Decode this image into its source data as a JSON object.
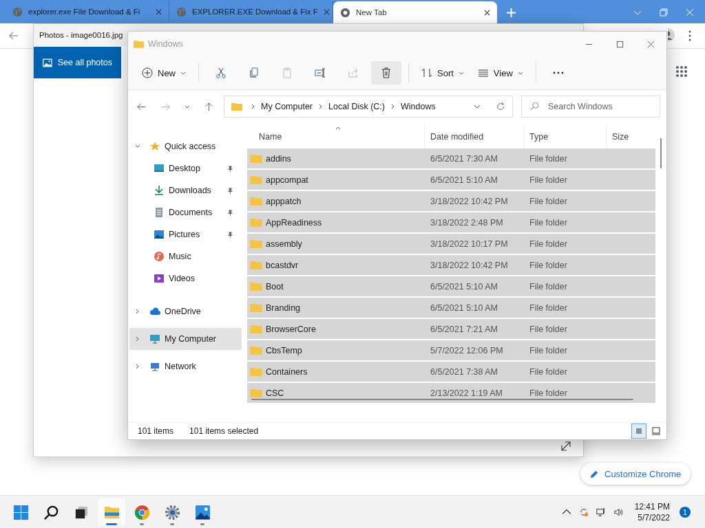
{
  "browser": {
    "tabs": [
      {
        "title": "explorer.exe File Download & Fi",
        "selected": false
      },
      {
        "title": "EXPLORER.EXE Download & Fix F",
        "selected": false
      },
      {
        "title": "New Tab",
        "selected": true
      }
    ],
    "customize_button": "Customize Chrome"
  },
  "photos_window": {
    "title": "Photos - image0016.jpg",
    "see_all": "See all photos"
  },
  "explorer": {
    "title": "Windows",
    "toolbar": {
      "new": "New",
      "sort": "Sort",
      "view": "View"
    },
    "breadcrumb": [
      "My Computer",
      "Local Disk (C:)",
      "Windows"
    ],
    "search": {
      "placeholder": "Search Windows"
    },
    "nav": [
      {
        "label": "Quick access",
        "kind": "star",
        "expanded": true,
        "selected": false,
        "children": [
          {
            "label": "Desktop",
            "kind": "desktop",
            "pinned": true,
            "selected": false
          },
          {
            "label": "Downloads",
            "kind": "downloads",
            "pinned": true,
            "selected": false
          },
          {
            "label": "Documents",
            "kind": "documents",
            "pinned": true,
            "selected": false
          },
          {
            "label": "Pictures",
            "kind": "pictures",
            "pinned": true,
            "selected": false
          },
          {
            "label": "Music",
            "kind": "music",
            "pinned": false,
            "selected": false
          },
          {
            "label": "Videos",
            "kind": "videos",
            "pinned": false,
            "selected": false
          }
        ]
      },
      {
        "label": "OneDrive",
        "kind": "cloud",
        "expanded": false,
        "selected": false
      },
      {
        "label": "My Computer",
        "kind": "computer",
        "expanded": false,
        "selected": true
      },
      {
        "label": "Network",
        "kind": "network",
        "expanded": false,
        "selected": false
      }
    ],
    "columns": [
      "Name",
      "Date modified",
      "Type",
      "Size"
    ],
    "rows": [
      {
        "name": "addins",
        "date": "6/5/2021 7:30 AM",
        "type": "File folder",
        "selected": true
      },
      {
        "name": "appcompat",
        "date": "6/5/2021 5:10 AM",
        "type": "File folder",
        "selected": true
      },
      {
        "name": "apppatch",
        "date": "3/18/2022 10:42 PM",
        "type": "File folder",
        "selected": true
      },
      {
        "name": "AppReadiness",
        "date": "3/18/2022 2:48 PM",
        "type": "File folder",
        "selected": true
      },
      {
        "name": "assembly",
        "date": "3/18/2022 10:17 PM",
        "type": "File folder",
        "selected": true
      },
      {
        "name": "bcastdvr",
        "date": "3/18/2022 10:42 PM",
        "type": "File folder",
        "selected": true
      },
      {
        "name": "Boot",
        "date": "6/5/2021 5:10 AM",
        "type": "File folder",
        "selected": true
      },
      {
        "name": "Branding",
        "date": "6/5/2021 5:10 AM",
        "type": "File folder",
        "selected": true
      },
      {
        "name": "BrowserCore",
        "date": "6/5/2021 7:21 AM",
        "type": "File folder",
        "selected": true
      },
      {
        "name": "CbsTemp",
        "date": "5/7/2022 12:06 PM",
        "type": "File folder",
        "selected": true
      },
      {
        "name": "Containers",
        "date": "6/5/2021 7:38 AM",
        "type": "File folder",
        "selected": true
      },
      {
        "name": "CSC",
        "date": "2/13/2022 1:19 AM",
        "type": "File folder",
        "selected": true
      }
    ],
    "status": {
      "count": "101 items",
      "selection": "101 items selected"
    }
  },
  "taskbar": {
    "apps": [
      {
        "kind": "start"
      },
      {
        "kind": "search"
      },
      {
        "kind": "taskview"
      },
      {
        "kind": "explorer",
        "running": true,
        "active": true
      },
      {
        "kind": "chrome",
        "running": true,
        "active": false
      },
      {
        "kind": "settings",
        "running": true,
        "active": false
      },
      {
        "kind": "photos",
        "running": true,
        "active": false
      }
    ],
    "time": "12:41 PM",
    "date": "5/7/2022",
    "notifications": "1"
  }
}
